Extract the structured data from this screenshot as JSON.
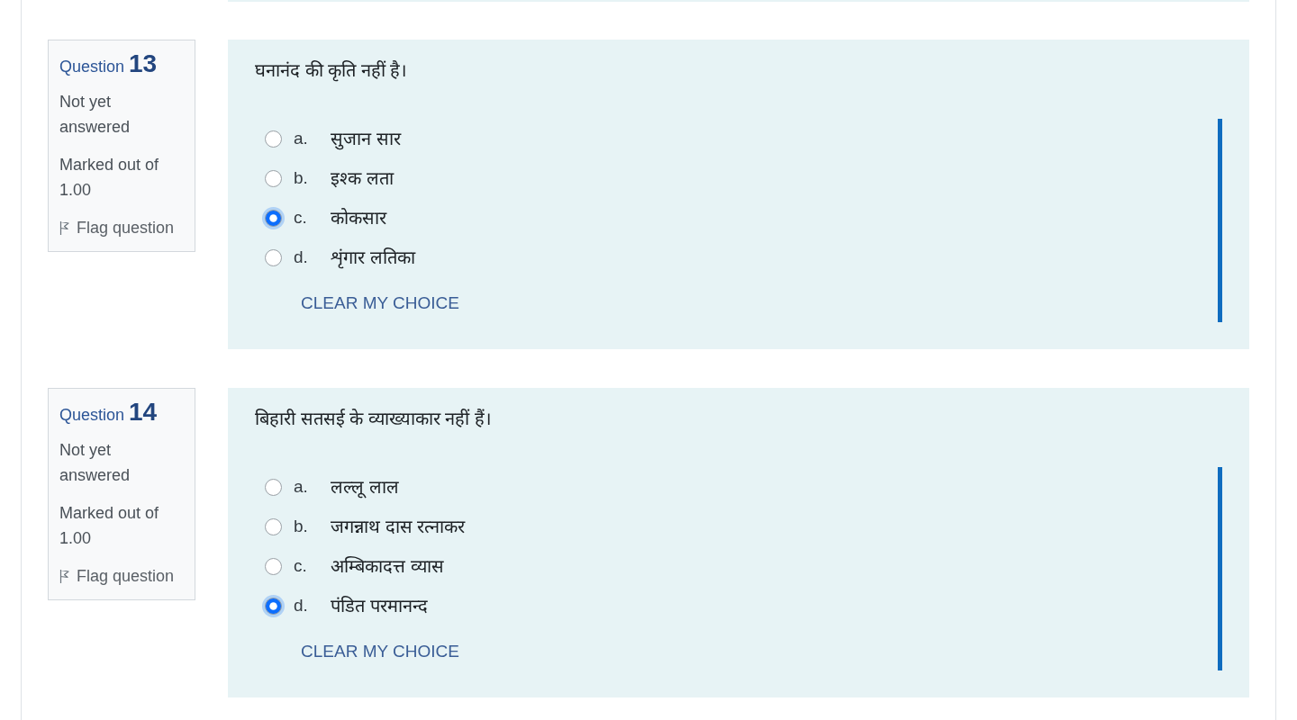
{
  "questions": [
    {
      "label": "Question",
      "number": "13",
      "status": "Not yet answered",
      "marked_out_of": "Marked out of 1.00",
      "flag": "Flag question",
      "text": "घनानंद की कृति नहीं है।",
      "options": [
        {
          "letter": "a.",
          "text": "सुजान सार",
          "selected": false
        },
        {
          "letter": "b.",
          "text": "इश्क लता",
          "selected": false
        },
        {
          "letter": "c.",
          "text": "कोकसार",
          "selected": true
        },
        {
          "letter": "d.",
          "text": "शृंगार लतिका",
          "selected": false
        }
      ],
      "clear": "CLEAR MY CHOICE"
    },
    {
      "label": "Question",
      "number": "14",
      "status": "Not yet answered",
      "marked_out_of": "Marked out of 1.00",
      "flag": "Flag question",
      "text": "बिहारी सतसई के व्याख्याकार नहीं हैं।",
      "options": [
        {
          "letter": "a.",
          "text": "लल्लू लाल",
          "selected": false
        },
        {
          "letter": "b.",
          "text": "जगन्नाथ दास रत्नाकर",
          "selected": false
        },
        {
          "letter": "c.",
          "text": "अम्बिकादत्त व्यास",
          "selected": false
        },
        {
          "letter": "d.",
          "text": "पंडित परमानन्द",
          "selected": true
        }
      ],
      "clear": "CLEAR MY CHOICE"
    }
  ]
}
